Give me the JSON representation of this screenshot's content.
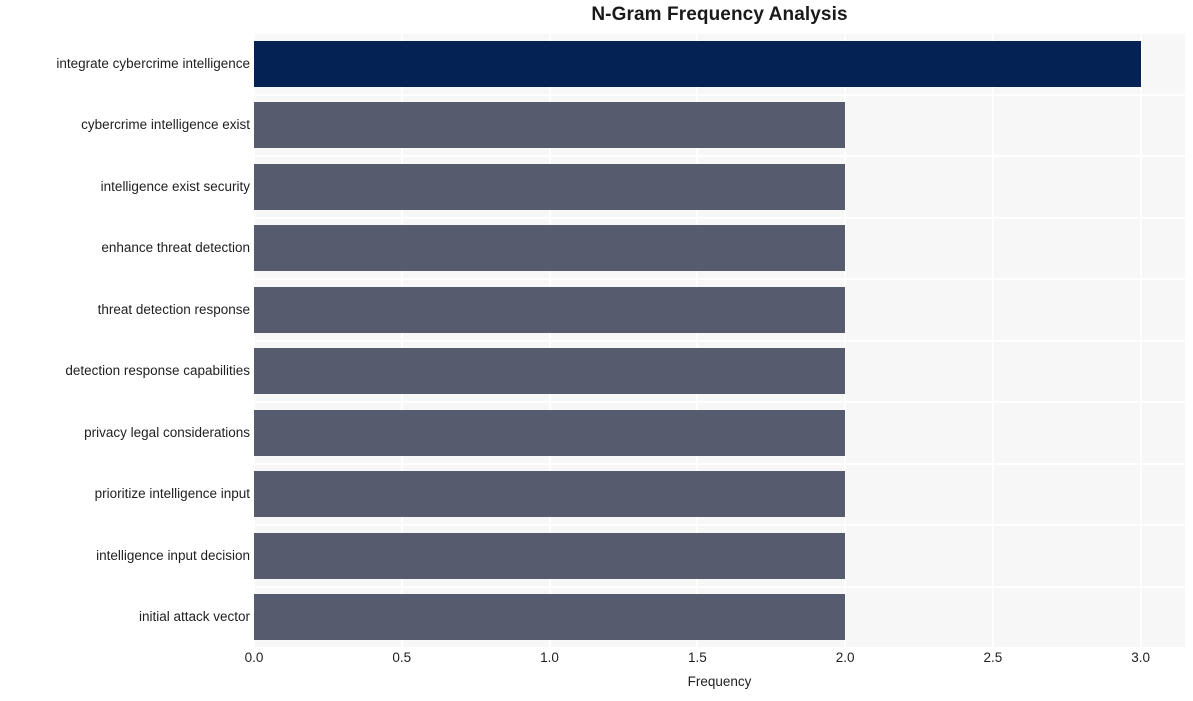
{
  "chart_data": {
    "type": "bar",
    "orientation": "horizontal",
    "title": "N-Gram Frequency Analysis",
    "xlabel": "Frequency",
    "ylabel": "",
    "xlim": [
      0.0,
      3.15
    ],
    "xticks": [
      "0.0",
      "0.5",
      "1.0",
      "1.5",
      "2.0",
      "2.5",
      "3.0"
    ],
    "xtick_values": [
      0.0,
      0.5,
      1.0,
      1.5,
      2.0,
      2.5,
      3.0
    ],
    "grid": true,
    "legend": "none",
    "categories": [
      "integrate cybercrime intelligence",
      "cybercrime intelligence exist",
      "intelligence exist security",
      "enhance threat detection",
      "threat detection response",
      "detection response capabilities",
      "privacy legal considerations",
      "prioritize intelligence input",
      "intelligence input decision",
      "initial attack vector"
    ],
    "values": [
      3,
      2,
      2,
      2,
      2,
      2,
      2,
      2,
      2,
      2
    ],
    "bar_colors": [
      "#042354",
      "#565b6e",
      "#565b6e",
      "#565b6e",
      "#565b6e",
      "#565b6e",
      "#565b6e",
      "#565b6e",
      "#565b6e",
      "#565b6e"
    ]
  },
  "style": {
    "figure_background": "#ffffff",
    "plot_background": "#f7f7f7",
    "grid_color": "#ffffff",
    "text_color": "#1f1f1f",
    "title_color": "#1a1a1a",
    "highlight_color": "#042354",
    "bar_color": "#565b6e"
  }
}
